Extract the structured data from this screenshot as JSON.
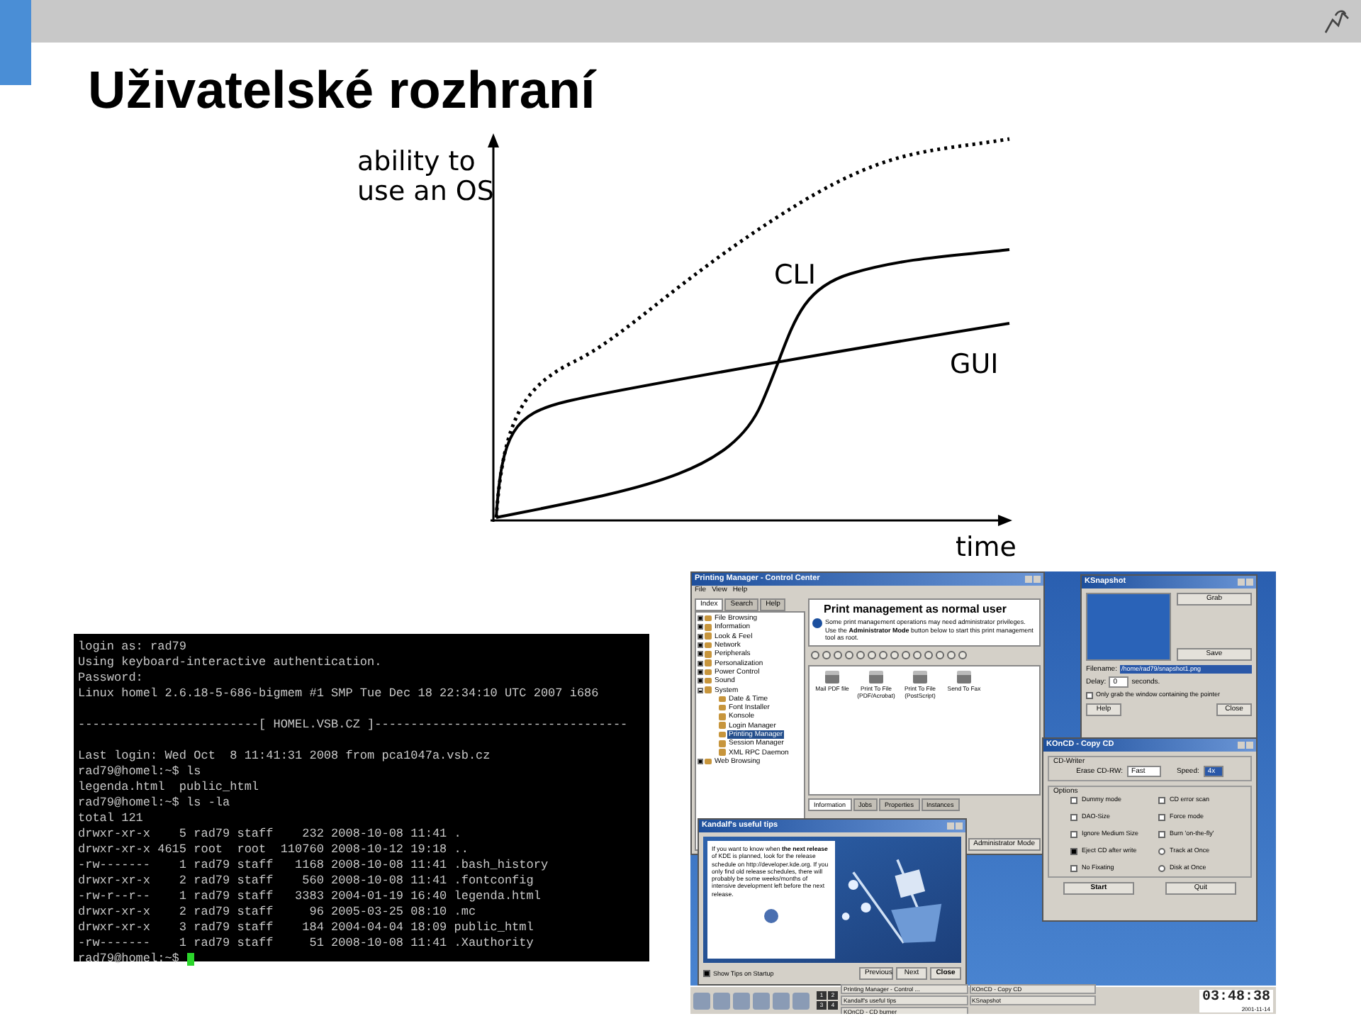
{
  "slide": {
    "title": "Uživatelské rozhraní"
  },
  "chart": {
    "ylabel": [
      "ability to",
      "use an OS"
    ],
    "xlabel": "time",
    "curves": [
      {
        "label": "CLI",
        "kind": "solid_s"
      },
      {
        "label": "GUI",
        "kind": "solid_log"
      },
      {
        "kind": "dotted"
      }
    ]
  },
  "terminal": {
    "blocks": [
      [
        "login as: rad79",
        "Using keyboard-interactive authentication.",
        "Password:",
        "Linux homel 2.6.18-5-686-bigmem #1 SMP Tue Dec 18 22:34:10 UTC 2007 i686"
      ],
      [
        "-------------------------[ HOMEL.VSB.CZ ]-----------------------------------"
      ],
      [
        "Last login: Wed Oct  8 11:41:31 2008 from pca1047a.vsb.cz",
        "rad79@homel:~$ ls",
        "legenda.html  public_html",
        "rad79@homel:~$ ls -la",
        "total 121",
        "drwxr-xr-x    5 rad79 staff    232 2008-10-08 11:41 .",
        "drwxr-xr-x 4615 root  root  110760 2008-10-12 19:18 ..",
        "-rw-------    1 rad79 staff   1168 2008-10-08 11:41 .bash_history",
        "drwxr-xr-x    2 rad79 staff    560 2008-10-08 11:41 .fontconfig",
        "-rw-r--r--    1 rad79 staff   3383 2004-01-19 16:40 legenda.html",
        "drwxr-xr-x    2 rad79 staff     96 2005-03-25 08:10 .mc",
        "drwxr-xr-x    3 rad79 staff    184 2004-04-04 18:09 public_html",
        "-rw-------    1 rad79 staff     51 2008-10-08 11:41 .Xauthority"
      ]
    ],
    "prompt": "rad79@homel:~$ "
  },
  "desktop": {
    "control_center": {
      "title": "Printing Manager - Control Center",
      "menu": [
        "File",
        "View",
        "Help"
      ],
      "tabs": [
        {
          "label": "Index",
          "selected": true
        },
        {
          "label": "Search",
          "selected": false
        },
        {
          "label": "Help",
          "selected": false
        }
      ],
      "tree": [
        {
          "label": "File Browsing",
          "expanded": false,
          "selected": false
        },
        {
          "label": "Information",
          "expanded": false,
          "selected": false
        },
        {
          "label": "Look & Feel",
          "expanded": false,
          "selected": false
        },
        {
          "label": "Network",
          "expanded": false,
          "selected": false
        },
        {
          "label": "Peripherals",
          "expanded": false,
          "selected": false
        },
        {
          "label": "Personalization",
          "expanded": false,
          "selected": false
        },
        {
          "label": "Power Control",
          "expanded": false,
          "selected": false
        },
        {
          "label": "Sound",
          "expanded": false,
          "selected": false
        },
        {
          "label": "System",
          "expanded": true,
          "selected": false,
          "children": [
            {
              "label": "Date & Time",
              "selected": false
            },
            {
              "label": "Font Installer",
              "selected": false
            },
            {
              "label": "Konsole",
              "selected": false
            },
            {
              "label": "Login Manager",
              "selected": false
            },
            {
              "label": "Printing Manager",
              "selected": true
            },
            {
              "label": "Session Manager",
              "selected": false
            },
            {
              "label": "XML RPC Daemon",
              "selected": false
            }
          ]
        },
        {
          "label": "Web Browsing",
          "expanded": false,
          "selected": false
        }
      ],
      "heading": "Print management as normal user",
      "description": "Some print management operations may need administrator privileges. Use the **Administrator Mode** button below to start this print management tool as root.",
      "printers": [
        {
          "label": "Mail PDF file"
        },
        {
          "label": "Print To File (PDF/Acrobat)"
        },
        {
          "label": "Print To File (PostScript)"
        },
        {
          "label": "Send To Fax"
        }
      ],
      "bottom_tabs": [
        {
          "label": "Information",
          "selected": true
        },
        {
          "label": "Jobs",
          "selected": false
        },
        {
          "label": "Properties",
          "selected": false
        },
        {
          "label": "Instances",
          "selected": false
        }
      ],
      "admin_button": "Administrator Mode"
    },
    "ksnapshot": {
      "title": "KSnapshot",
      "grab": "Grab",
      "save": "Save",
      "filename_label": "Filename:",
      "filename": "/home/rad79/snapshot1.png",
      "delay_label": "Delay:",
      "delay": "0",
      "delay_unit": "seconds.",
      "only_window": {
        "label": "Only grab the window containing the pointer",
        "checked": false
      },
      "help": "Help",
      "close": "Close"
    },
    "koncd": {
      "title": "KOnCD - Copy CD",
      "writer_group": "CD-Writer",
      "erase_label": "Erase CD-RW:",
      "erase_value": "Fast",
      "speed_label": "Speed:",
      "speed_value": "4x",
      "options_group": "Options",
      "options": [
        {
          "label": "Dummy mode",
          "kind": "checkbox",
          "checked": false
        },
        {
          "label": "CD error scan",
          "kind": "checkbox",
          "checked": false
        },
        {
          "label": "DAO-Size",
          "kind": "checkbox",
          "checked": false
        },
        {
          "label": "Force mode",
          "kind": "checkbox",
          "checked": false
        },
        {
          "label": "Ignore Medium Size",
          "kind": "checkbox",
          "checked": false
        },
        {
          "label": "Burn 'on-the-fly'",
          "kind": "checkbox",
          "checked": false
        },
        {
          "label": "Eject CD after write",
          "kind": "checkbox",
          "checked": true
        },
        {
          "label": "Track at Once",
          "kind": "radio",
          "checked": false
        },
        {
          "label": "No Fixating",
          "kind": "checkbox",
          "checked": false
        },
        {
          "label": "Disk at Once",
          "kind": "radio",
          "checked": false
        }
      ],
      "start": "Start",
      "quit": "Quit"
    },
    "tips": {
      "title": "Kandalf's useful tips",
      "text": "If you want to know when **the next release** of KDE is planned, look for the release schedule on http://developer.kde.org. If you only find old release schedules, there will probably be some weeks/months of intensive development left before the next release.",
      "show_on_startup": {
        "label": "Show Tips on Startup",
        "checked": true
      },
      "previous": "Previous",
      "next": "Next",
      "close": "Close"
    },
    "taskbar": {
      "desktops": [
        "1",
        "2",
        "3",
        "4"
      ],
      "tasks": [
        {
          "label": "Printing Manager - Control ..."
        },
        {
          "label": "Kandalf's useful tips"
        },
        {
          "label": "KOnCD - CD burner"
        },
        {
          "label": "KOnCD - Copy CD"
        },
        {
          "label": "KSnapshot"
        }
      ],
      "clock": "03:48:38",
      "date": "2001-11-14"
    }
  }
}
